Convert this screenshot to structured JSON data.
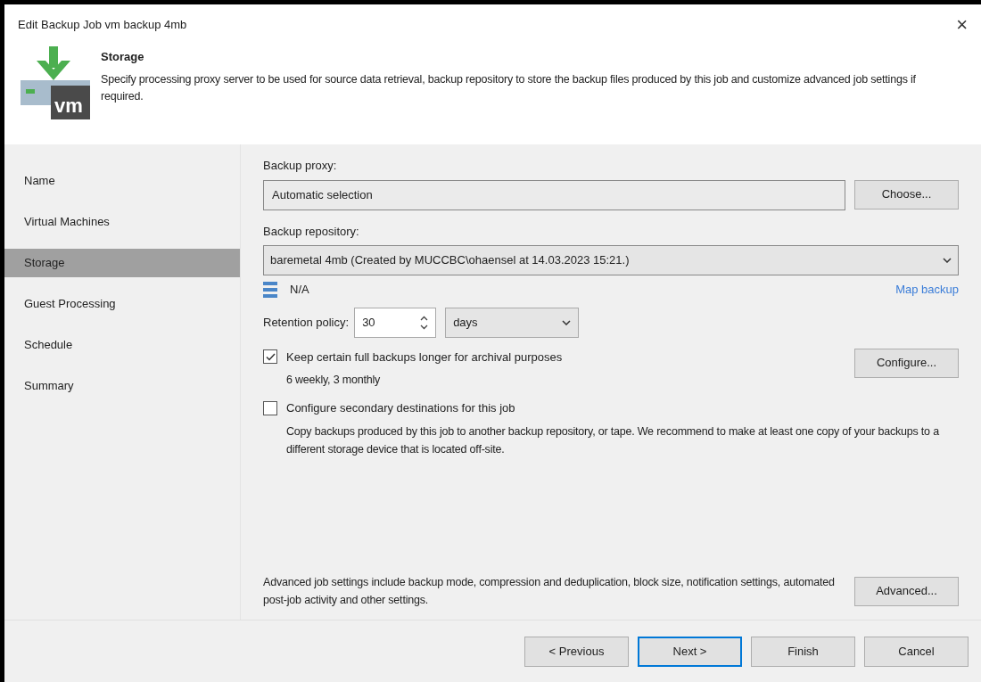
{
  "window": {
    "title": "Edit Backup Job vm backup 4mb",
    "close": "×"
  },
  "header": {
    "logo_text": "vm",
    "title": "Storage",
    "description": "Specify processing proxy server to be used for source data retrieval, backup repository to store the backup files produced by this job and customize advanced job settings if required."
  },
  "sidebar": {
    "items": [
      {
        "label": "Name",
        "selected": false
      },
      {
        "label": "Virtual Machines",
        "selected": false
      },
      {
        "label": "Storage",
        "selected": true
      },
      {
        "label": "Guest Processing",
        "selected": false
      },
      {
        "label": "Schedule",
        "selected": false
      },
      {
        "label": "Summary",
        "selected": false
      }
    ]
  },
  "backup_proxy": {
    "label": "Backup proxy:",
    "value": "Automatic selection",
    "button": "Choose..."
  },
  "backup_repository": {
    "label": "Backup repository:",
    "value": "baremetal 4mb (Created by MUCCBC\\ohaensel at 14.03.2023 15:21.)",
    "status": "N/A",
    "link": "Map backup"
  },
  "retention": {
    "label": "Retention policy:",
    "value": "30",
    "unit": "days"
  },
  "options": [
    {
      "label": "Keep certain full backups longer for archival purposes",
      "checked": true,
      "detail": "6 weekly, 3 monthly",
      "button": "Configure..."
    },
    {
      "label": "Configure secondary destinations for this job",
      "checked": false,
      "detail": "Copy backups produced by this job to another backup repository, or tape. We recommend to make at least one copy of your backups to a different storage device that is located off-site."
    }
  ],
  "advanced": {
    "text": "Advanced job settings include backup mode, compression and deduplication, block size, notification settings, automated post-job activity and other settings.",
    "button": "Advanced..."
  },
  "buttons": [
    {
      "label": "< Previous",
      "selected": false
    },
    {
      "label": "Next >",
      "selected": true
    },
    {
      "label": "Finish",
      "selected": false
    },
    {
      "label": "Cancel",
      "selected": false
    }
  ]
}
